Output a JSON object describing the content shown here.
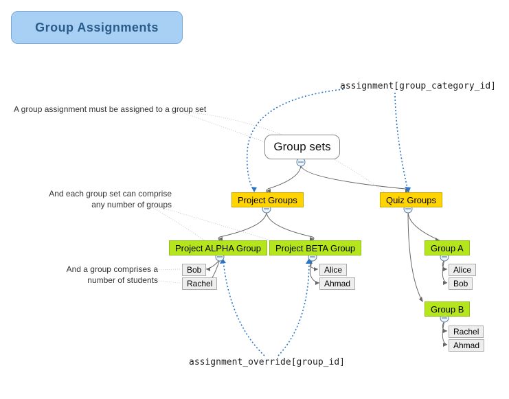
{
  "title": "Group Assignments",
  "api_labels": {
    "group_category": "assignment[group_category_id]",
    "group_id": "assignment_override[group_id]"
  },
  "annotations": {
    "a1": "A group assignment must be assigned to a group set",
    "a2_line1": "And each group set can comprise",
    "a2_line2": "any number of groups",
    "a3_line1": "And a group comprises a",
    "a3_line2": "number of students"
  },
  "root": {
    "label": "Group sets"
  },
  "sets": {
    "project": {
      "label": "Project Groups",
      "groups": {
        "alpha": {
          "label": "Project ALPHA Group",
          "members": [
            "Bob",
            "Rachel"
          ]
        },
        "beta": {
          "label": "Project BETA Group",
          "members": [
            "Alice",
            "Ahmad"
          ]
        }
      }
    },
    "quiz": {
      "label": "Quiz Groups",
      "groups": {
        "a": {
          "label": "Group A",
          "members": [
            "Alice",
            "Bob"
          ]
        },
        "b": {
          "label": "Group B",
          "members": [
            "Rachel",
            "Ahmad"
          ]
        }
      }
    }
  }
}
